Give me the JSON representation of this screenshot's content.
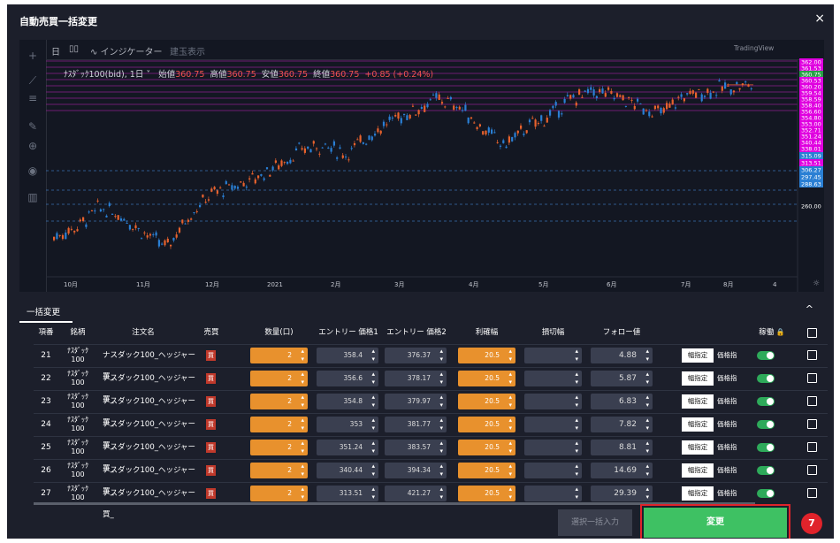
{
  "dialog": {
    "title": "自動売買一括変更",
    "close": "×"
  },
  "toolbar": {
    "day": "日",
    "indicator": "インジケーター",
    "build": "建玉表示",
    "brand": "TradingView"
  },
  "price_header": {
    "symbol": "ﾅｽﾀﾞｯｸ100(bid), 1日 ˅",
    "open_label": "始値",
    "open": "360.75",
    "high_label": "高値",
    "high": "360.75",
    "low_label": "安値",
    "low": "360.75",
    "close_label": "終値",
    "close": "360.75",
    "change": "+0.85 (+0.24%)"
  },
  "chart_data": {
    "type": "candlestick",
    "x_ticks": [
      "10月",
      "11月",
      "12月",
      "2021",
      "2月",
      "3月",
      "4月",
      "5月",
      "6月",
      "7月",
      "8月",
      "4"
    ],
    "y_ticks": [
      "362.00",
      "361.53",
      "360.75",
      "360.53",
      "360.20",
      "359.54",
      "358.59",
      "358.40",
      "356.60",
      "354.80",
      "353.00",
      "352.71",
      "351.24",
      "340.44",
      "338.01",
      "315.09",
      "313.51",
      "306.27",
      "297.45",
      "288.63",
      "260.00"
    ],
    "close_approx": [
      255,
      262,
      275,
      270,
      258,
      248,
      270,
      285,
      290,
      296,
      305,
      315,
      318,
      312,
      325,
      335,
      342,
      350,
      345,
      330,
      318,
      330,
      338,
      350,
      355,
      352,
      345,
      340,
      352,
      355,
      358,
      360
    ]
  },
  "bulk": {
    "label": "一括変更",
    "chevron": "^"
  },
  "table": {
    "headers": [
      "項番",
      "銘柄",
      "注文名",
      "売買",
      "数量(口)",
      "エントリー 価格1",
      "エントリー 価格2",
      "利確幅",
      "損切幅",
      "フォロー値",
      "",
      "",
      "稼働",
      ""
    ],
    "rows": [
      {
        "no": "21",
        "sym1": "ﾅｽﾀﾞｯｸ",
        "sym2": "100",
        "name": "ナスダック100_ヘッジャー買_",
        "side": "買",
        "qty": "2",
        "p1": "358.4",
        "p2": "376.37",
        "tp": "20.5",
        "sl": "",
        "follow": "4.88",
        "w": "幅指定",
        "p": "価格指"
      },
      {
        "no": "22",
        "sym1": "ﾅｽﾀﾞｯｸ",
        "sym2": "100",
        "name": "ナスダック100_ヘッジャー買_",
        "side": "買",
        "qty": "2",
        "p1": "356.6",
        "p2": "378.17",
        "tp": "20.5",
        "sl": "",
        "follow": "5.87",
        "w": "幅指定",
        "p": "価格指"
      },
      {
        "no": "23",
        "sym1": "ﾅｽﾀﾞｯｸ",
        "sym2": "100",
        "name": "ナスダック100_ヘッジャー買_",
        "side": "買",
        "qty": "2",
        "p1": "354.8",
        "p2": "379.97",
        "tp": "20.5",
        "sl": "",
        "follow": "6.83",
        "w": "幅指定",
        "p": "価格指"
      },
      {
        "no": "24",
        "sym1": "ﾅｽﾀﾞｯｸ",
        "sym2": "100",
        "name": "ナスダック100_ヘッジャー買_",
        "side": "買",
        "qty": "2",
        "p1": "353",
        "p2": "381.77",
        "tp": "20.5",
        "sl": "",
        "follow": "7.82",
        "w": "幅指定",
        "p": "価格指"
      },
      {
        "no": "25",
        "sym1": "ﾅｽﾀﾞｯｸ",
        "sym2": "100",
        "name": "ナスダック100_ヘッジャー買_",
        "side": "買",
        "qty": "2",
        "p1": "351.24",
        "p2": "383.57",
        "tp": "20.5",
        "sl": "",
        "follow": "8.81",
        "w": "幅指定",
        "p": "価格指"
      },
      {
        "no": "26",
        "sym1": "ﾅｽﾀﾞｯｸ",
        "sym2": "100",
        "name": "ナスダック100_ヘッジャー買_",
        "side": "買",
        "qty": "2",
        "p1": "340.44",
        "p2": "394.34",
        "tp": "20.5",
        "sl": "",
        "follow": "14.69",
        "w": "幅指定",
        "p": "価格指"
      },
      {
        "no": "27",
        "sym1": "ﾅｽﾀﾞｯｸ",
        "sym2": "100",
        "name": "ナスダック100_ヘッジャー買_",
        "side": "買",
        "qty": "2",
        "p1": "313.51",
        "p2": "421.27",
        "tp": "20.5",
        "sl": "",
        "follow": "29.39",
        "w": "幅指定",
        "p": "価格指"
      }
    ]
  },
  "footer": {
    "bulk_input": "選択一括入力",
    "change": "変更",
    "step": "7"
  },
  "colors": {
    "bg": "#1c1f2b",
    "chart_bg": "#131722",
    "accent_orange": "#e8912d",
    "green": "#3ec163",
    "red": "#e0232b",
    "magenta": "#e000e0",
    "blue": "#2a7fd4"
  }
}
